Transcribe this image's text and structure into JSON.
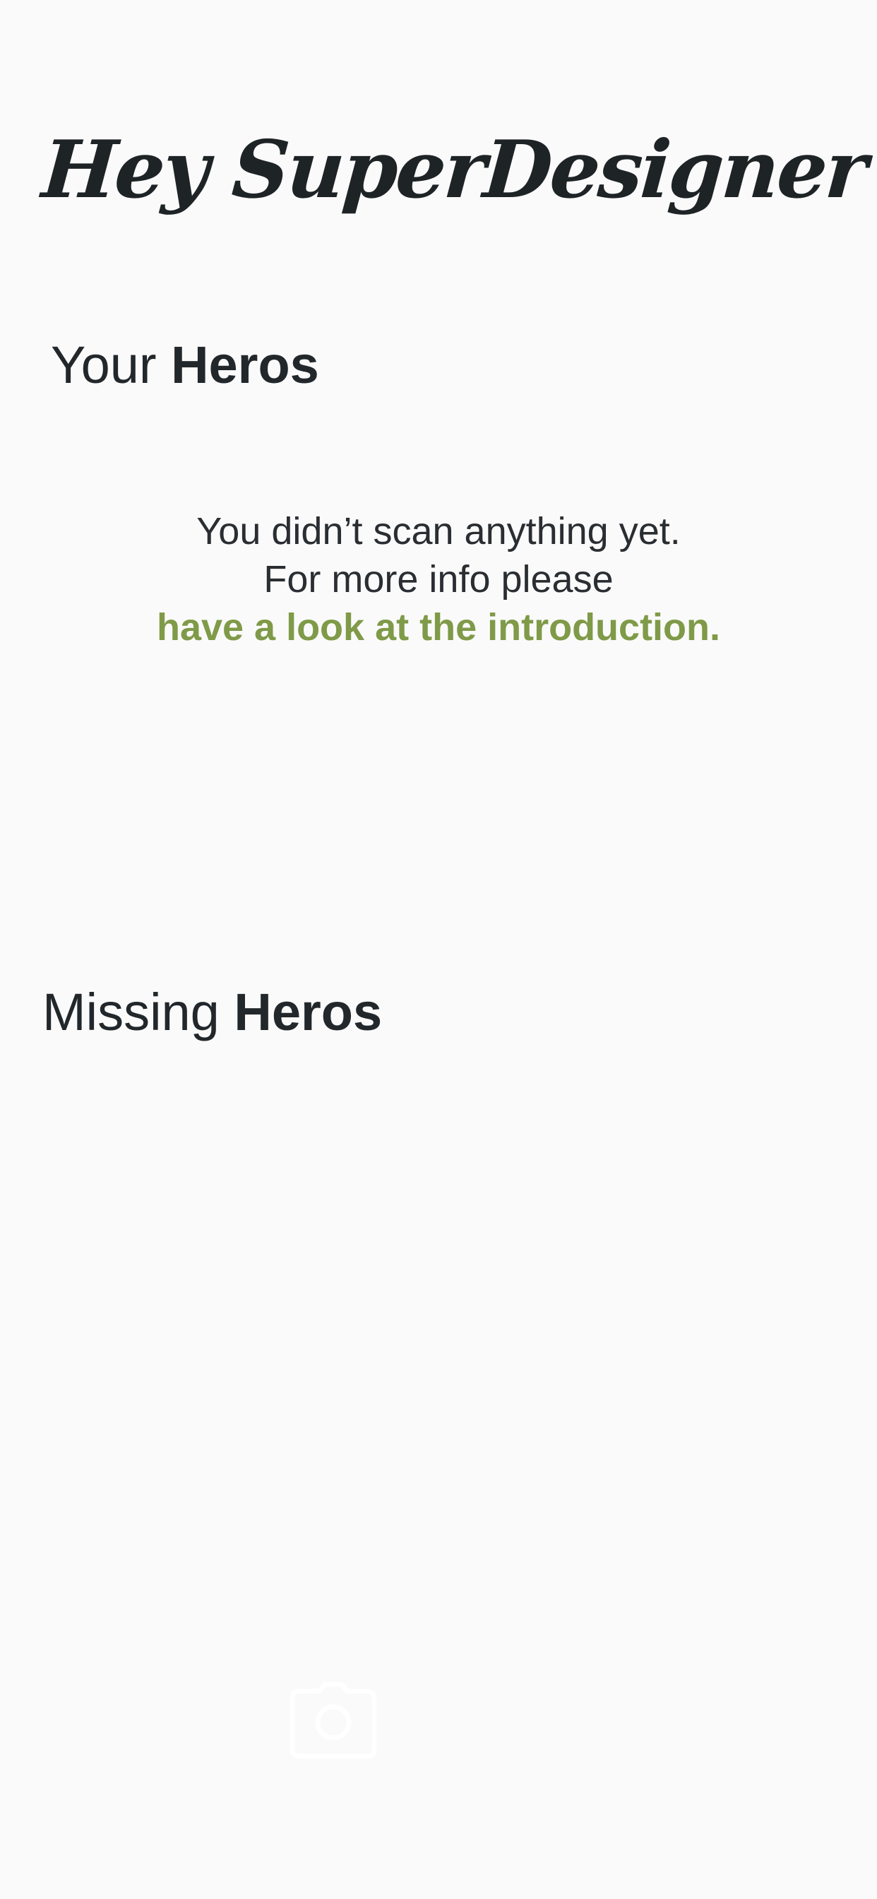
{
  "header": {
    "greeting": "Hey SuperDesigner !"
  },
  "your_heros": {
    "title_light": "Your ",
    "title_bold": "Heros",
    "empty_message_line1": "You didn’t scan anything yet.",
    "empty_message_line2": "For more info please",
    "introduction_link": "have a look at the introduction."
  },
  "missing_heros": {
    "title_light": "Missing ",
    "title_bold": "Heros"
  },
  "scan_button": {
    "icon": "camera-icon"
  },
  "colors": {
    "background": "#fafafa",
    "text": "#22272b",
    "accent": "#7f9a48",
    "camera_icon": "#ffffff"
  }
}
